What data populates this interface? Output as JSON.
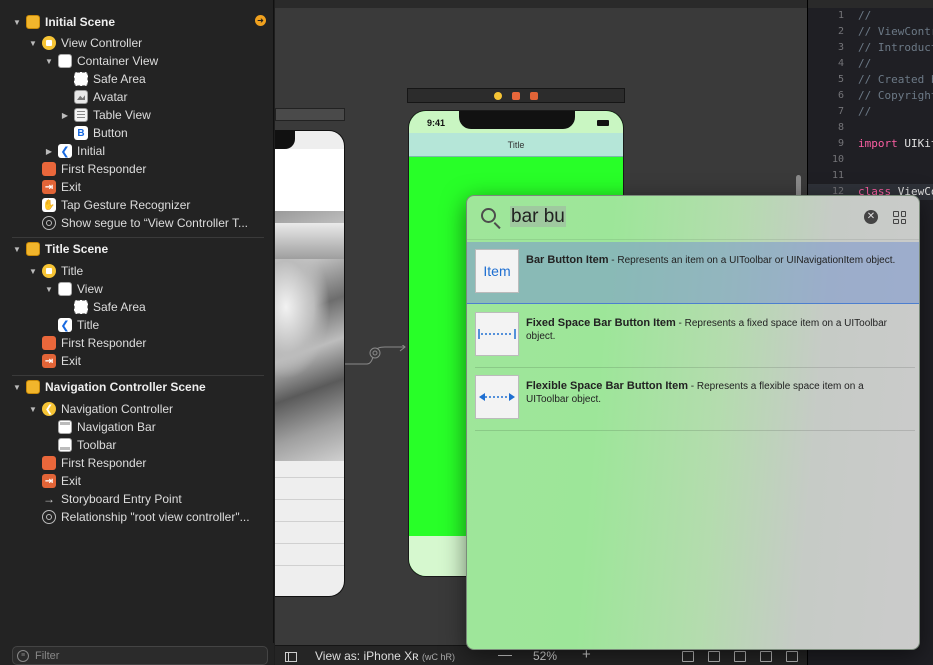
{
  "outline": {
    "rows": [
      {
        "label": "Initial Scene",
        "depth": 0,
        "icon": "scene",
        "scene": true,
        "tri": "▼"
      },
      {
        "label": "View Controller",
        "depth": 1,
        "icon": "vc",
        "tri": "▼"
      },
      {
        "label": "Container View",
        "depth": 2,
        "icon": "view",
        "tri": "▼"
      },
      {
        "label": "Safe Area",
        "depth": 3,
        "icon": "safe",
        "tri": ""
      },
      {
        "label": "Avatar",
        "depth": 3,
        "icon": "img",
        "tri": ""
      },
      {
        "label": "Table View",
        "depth": 3,
        "icon": "table",
        "tri": "▶"
      },
      {
        "label": "Button",
        "depth": 3,
        "icon": "btn",
        "tri": ""
      },
      {
        "label": "Initial",
        "depth": 2,
        "icon": "back",
        "tri": "▶"
      },
      {
        "label": "First Responder",
        "depth": 1,
        "icon": "resp",
        "tri": ""
      },
      {
        "label": "Exit",
        "depth": 1,
        "icon": "exit",
        "tri": ""
      },
      {
        "label": "Tap Gesture Recognizer",
        "depth": 1,
        "icon": "tap",
        "tri": ""
      },
      {
        "label": "Show segue to “View Controller T...",
        "depth": 1,
        "icon": "segue",
        "tri": ""
      },
      {
        "label": "Title Scene",
        "depth": 0,
        "icon": "scene",
        "scene": true,
        "tri": "▼"
      },
      {
        "label": "Title",
        "depth": 1,
        "icon": "vc",
        "tri": "▼"
      },
      {
        "label": "View",
        "depth": 2,
        "icon": "view",
        "tri": "▼"
      },
      {
        "label": "Safe Area",
        "depth": 3,
        "icon": "safe",
        "tri": ""
      },
      {
        "label": "Title",
        "depth": 2,
        "icon": "back",
        "tri": ""
      },
      {
        "label": "First Responder",
        "depth": 1,
        "icon": "resp",
        "tri": ""
      },
      {
        "label": "Exit",
        "depth": 1,
        "icon": "exit",
        "tri": ""
      },
      {
        "label": "Navigation Controller Scene",
        "depth": 0,
        "icon": "scene",
        "scene": true,
        "tri": "▼"
      },
      {
        "label": "Navigation Controller",
        "depth": 1,
        "icon": "nav",
        "tri": "▼"
      },
      {
        "label": "Navigation Bar",
        "depth": 2,
        "icon": "navbar",
        "tri": ""
      },
      {
        "label": "Toolbar",
        "depth": 2,
        "icon": "toolbar",
        "tri": ""
      },
      {
        "label": "First Responder",
        "depth": 1,
        "icon": "resp",
        "tri": ""
      },
      {
        "label": "Exit",
        "depth": 1,
        "icon": "exit",
        "tri": ""
      },
      {
        "label": "Storyboard Entry Point",
        "depth": 1,
        "icon": "arrow",
        "tri": ""
      },
      {
        "label": "Relationship \"root view controller\"...",
        "depth": 1,
        "icon": "segue",
        "tri": ""
      }
    ],
    "filter_placeholder": "Filter"
  },
  "canvas": {
    "phone_time": "9:41",
    "nav_title": "Title"
  },
  "bottombar": {
    "view_as": "View as: iPhone Xʀ",
    "size_class": "(wC hR)",
    "minus": "—",
    "zoom": "52%",
    "plus": "+"
  },
  "editor": {
    "lines": [
      {
        "n": "1",
        "text": "//",
        "cls": "cmt"
      },
      {
        "n": "2",
        "text": "//  ViewController.swift",
        "cls": "cmt"
      },
      {
        "n": "3",
        "text": "//  Introduction",
        "cls": "cmt"
      },
      {
        "n": "4",
        "text": "//",
        "cls": "cmt"
      },
      {
        "n": "5",
        "text": "//  Created by",
        "cls": "cmt"
      },
      {
        "n": "6",
        "text": "//  Copyright",
        "cls": "cmt"
      },
      {
        "n": "7",
        "text": "//",
        "cls": "cmt"
      },
      {
        "n": "8",
        "text": "",
        "cls": "plain"
      },
      {
        "n": "9",
        "text": "import UIKit",
        "cls": "import"
      },
      {
        "n": "10",
        "text": "",
        "cls": "plain"
      },
      {
        "n": "11",
        "text": "",
        "cls": "plain"
      },
      {
        "n": "12",
        "text": "class ViewController",
        "cls": "class"
      }
    ]
  },
  "library": {
    "query_text": "bar bu",
    "items": [
      {
        "thumb": "Item",
        "name": "Bar Button Item",
        "desc": " - Represents an item on a UIToolbar or UINavigationItem object.",
        "selected": true
      },
      {
        "thumb": "fixed",
        "name": "Fixed Space Bar Button Item",
        "desc": " - Represents a fixed space item on a UIToolbar object.",
        "selected": false
      },
      {
        "thumb": "flex",
        "name": "Flexible Space Bar Button Item",
        "desc": " - Represents a flexible space item on a UIToolbar object.",
        "selected": false
      }
    ]
  },
  "colors": {
    "phone_green": "#28ff28",
    "nav_teal": "#b5e6d8",
    "selection_blue": "#4d7fcf",
    "accent_orange": "#f0a11e"
  }
}
